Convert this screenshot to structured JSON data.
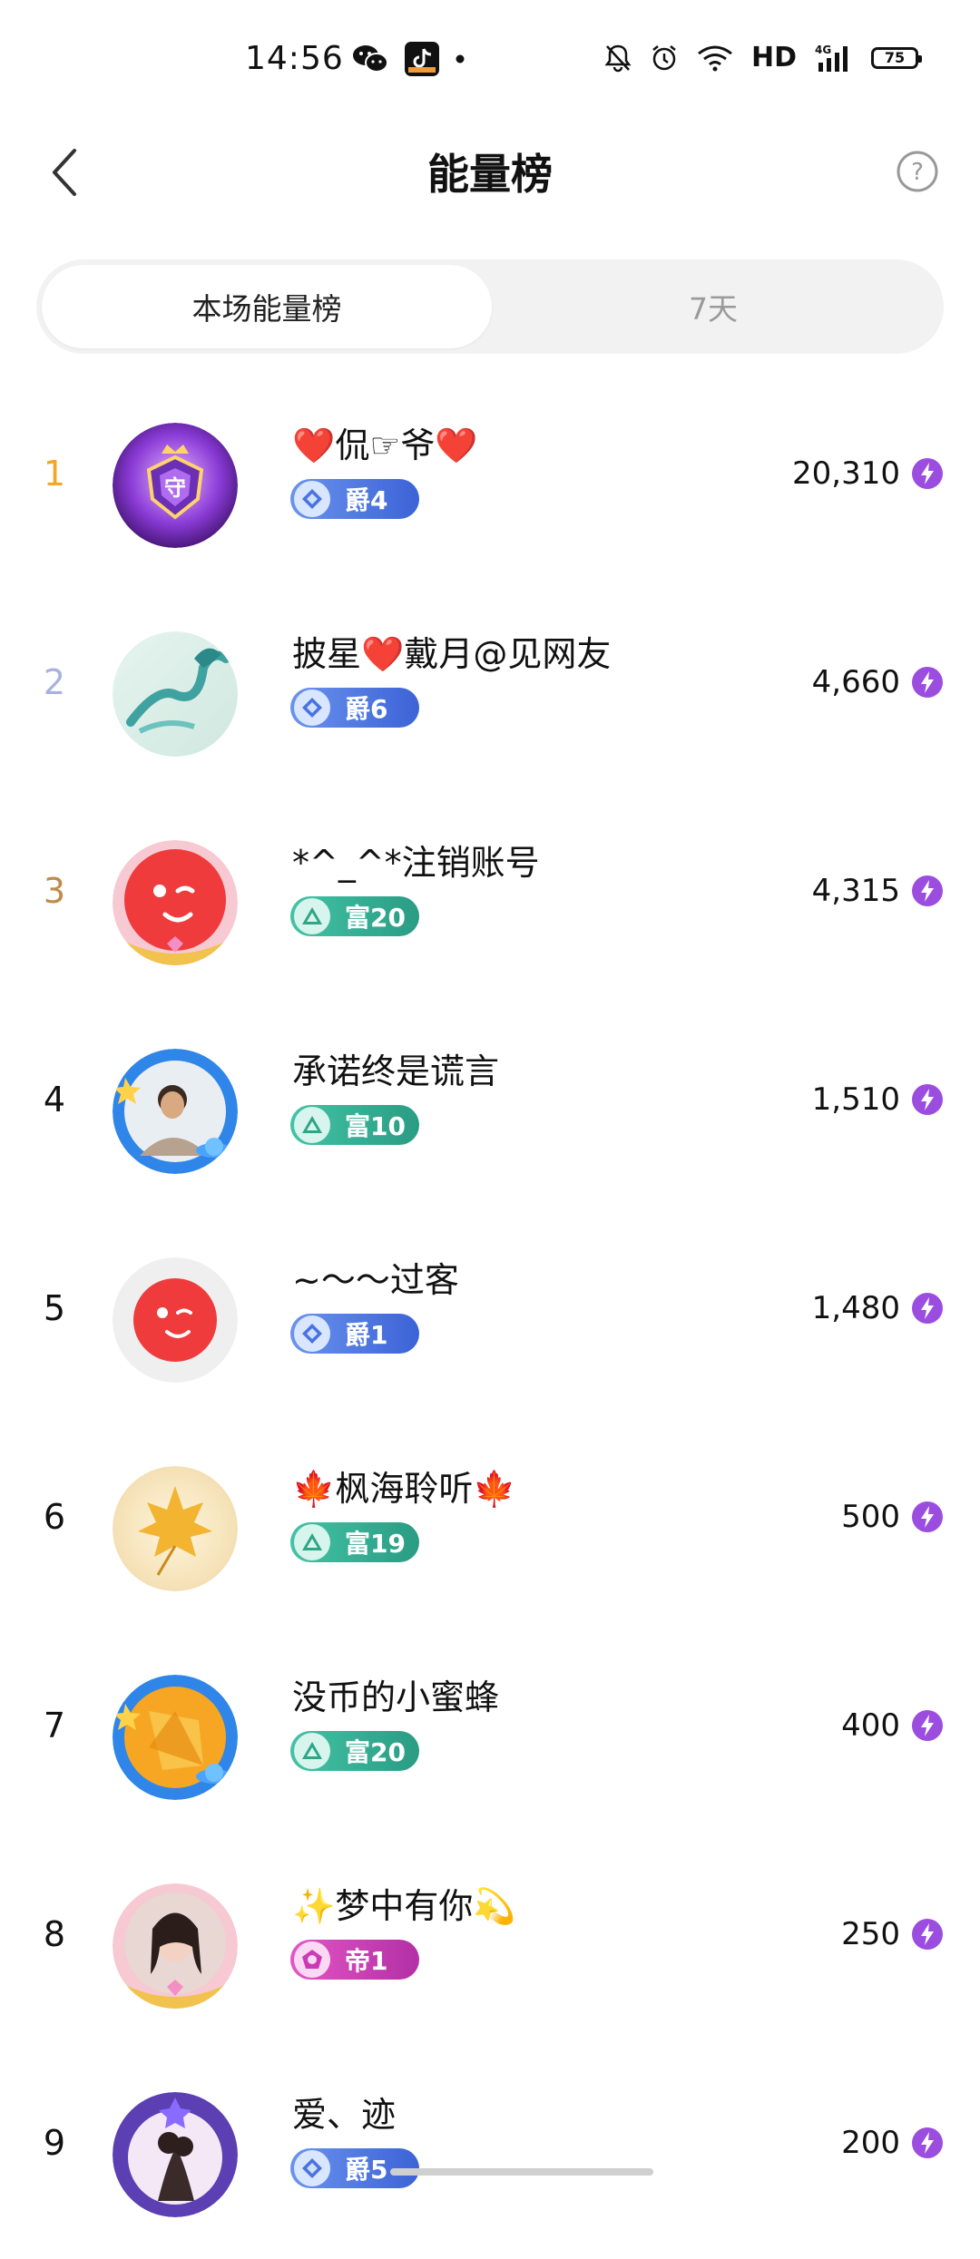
{
  "status_bar": {
    "time": "14:56",
    "hd": "HD",
    "battery": "75",
    "signal": "4G"
  },
  "header": {
    "title": "能量榜",
    "help": "?"
  },
  "tabs": [
    {
      "label": "本场能量榜",
      "active": true
    },
    {
      "label": "7天",
      "active": false
    }
  ],
  "rows": [
    {
      "rank": "1",
      "name": "❤️侃☞爷❤️",
      "badge": "爵4",
      "badge_type": "jue",
      "score": "20,310",
      "rank_color": "#f5a623"
    },
    {
      "rank": "2",
      "name": "披星❤️戴月@见网友",
      "badge": "爵6",
      "badge_type": "jue",
      "score": "4,660",
      "rank_color": "#a9b1e0"
    },
    {
      "rank": "3",
      "name": "*^_^*注销账号",
      "badge": "富20",
      "badge_type": "fu",
      "score": "4,315",
      "rank_color": "#c08a4a"
    },
    {
      "rank": "4",
      "name": "承诺终是谎言",
      "badge": "富10",
      "badge_type": "fu",
      "score": "1,510",
      "rank_color": "#111111"
    },
    {
      "rank": "5",
      "name": "~〜〜过客",
      "badge": "爵1",
      "badge_type": "jue",
      "score": "1,480",
      "rank_color": "#111111"
    },
    {
      "rank": "6",
      "name": "🍁枫海聆听🍁",
      "badge": "富19",
      "badge_type": "fu",
      "score": "500",
      "rank_color": "#111111"
    },
    {
      "rank": "7",
      "name": "没币的小蜜蜂",
      "badge": "富20",
      "badge_type": "fu",
      "score": "400",
      "rank_color": "#111111"
    },
    {
      "rank": "8",
      "name": "✨梦中有你💫",
      "badge": "帝1",
      "badge_type": "di",
      "score": "250",
      "rank_color": "#111111"
    },
    {
      "rank": "9",
      "name": "爱、迹",
      "badge": "爵5",
      "badge_type": "jue",
      "score": "200",
      "rank_color": "#111111"
    }
  ],
  "icons": {
    "back": "chevron-left-icon",
    "help": "question-circle-icon",
    "energy": "lightning-bolt-icon"
  },
  "colors": {
    "energy": "#9b4de0",
    "tab_bg": "#f2f2f2"
  }
}
